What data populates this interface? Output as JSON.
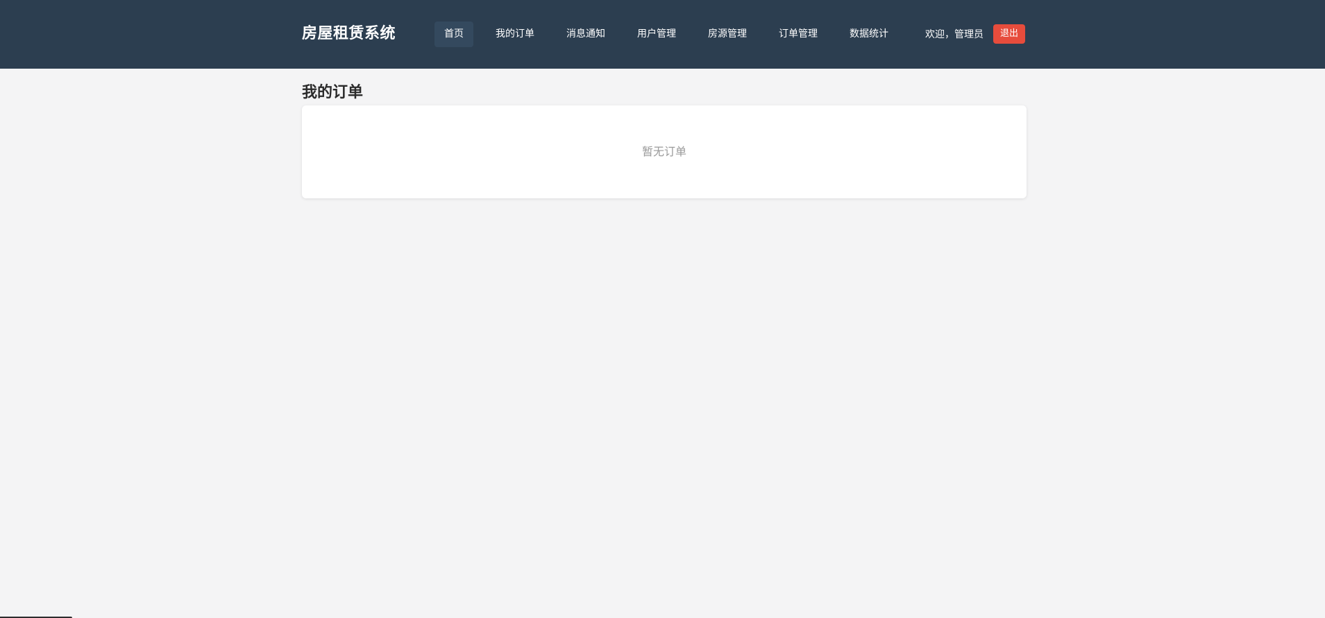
{
  "header": {
    "brand": "房屋租赁系统",
    "nav": [
      {
        "label": "首页",
        "active": true
      },
      {
        "label": "我的订单",
        "active": false
      },
      {
        "label": "消息通知",
        "active": false
      },
      {
        "label": "用户管理",
        "active": false
      },
      {
        "label": "房源管理",
        "active": false
      },
      {
        "label": "订单管理",
        "active": false
      },
      {
        "label": "数据统计",
        "active": false
      }
    ],
    "welcome": "欢迎，管理员",
    "logout_label": "退出"
  },
  "main": {
    "title": "我的订单",
    "empty_text": "暂无订单"
  },
  "colors": {
    "header_bg": "#2c3e50",
    "nav_active_bg": "#34495e",
    "logout_bg": "#e74c3c",
    "page_bg": "#f4f4f5"
  }
}
